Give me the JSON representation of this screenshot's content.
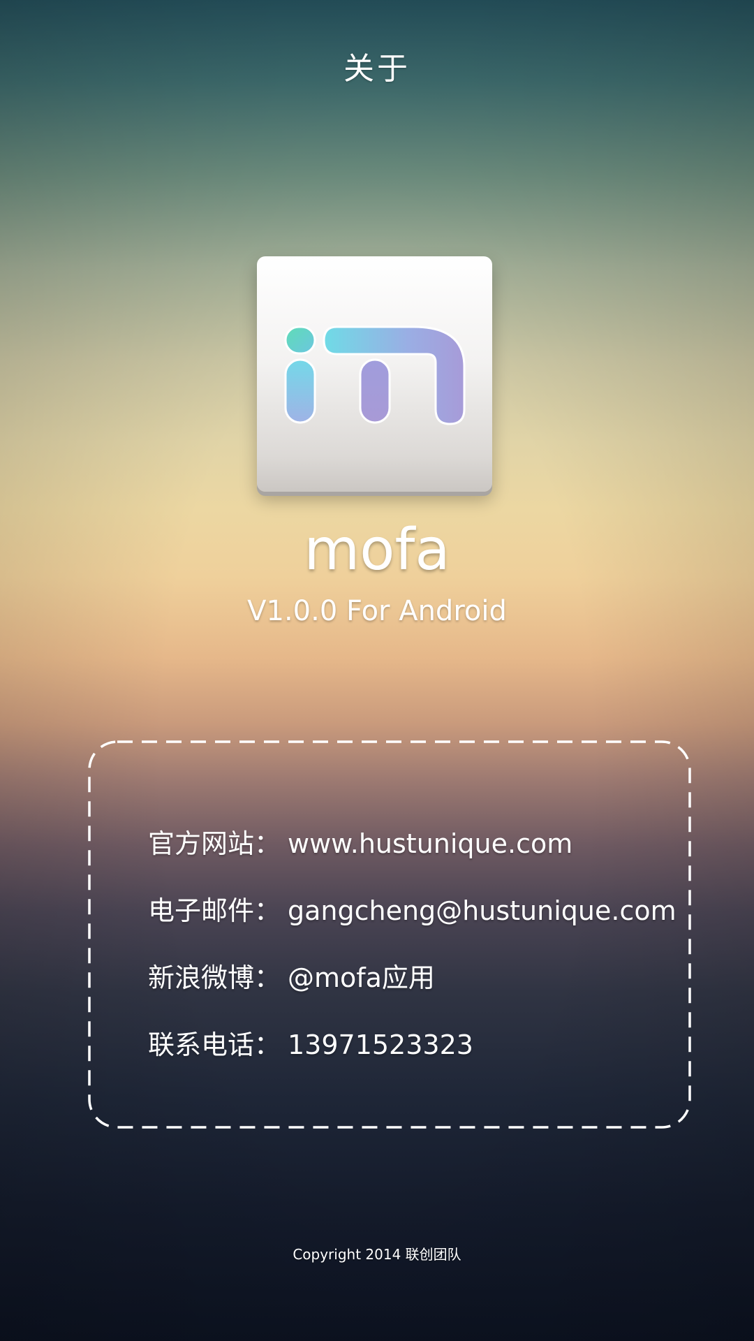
{
  "header": {
    "title": "关于"
  },
  "app": {
    "icon": "mofa-logo-icon",
    "name": "mofa",
    "version": "V1.0.0 For Android"
  },
  "contact": {
    "items": [
      {
        "label": "官方网站：",
        "value": "www.hustunique.com"
      },
      {
        "label": "电子邮件：",
        "value": "gangcheng@hustunique.com"
      },
      {
        "label": "新浪微博：",
        "value": "@mofa应用"
      },
      {
        "label": "联系电话：",
        "value": "13971523323"
      }
    ]
  },
  "footer": {
    "copyright": "Copyright  2014  联创团队"
  },
  "colors": {
    "logo_teal": "#6fdbe0",
    "logo_purple": "#a29bd6",
    "logo_green": "#5fcfb0"
  }
}
